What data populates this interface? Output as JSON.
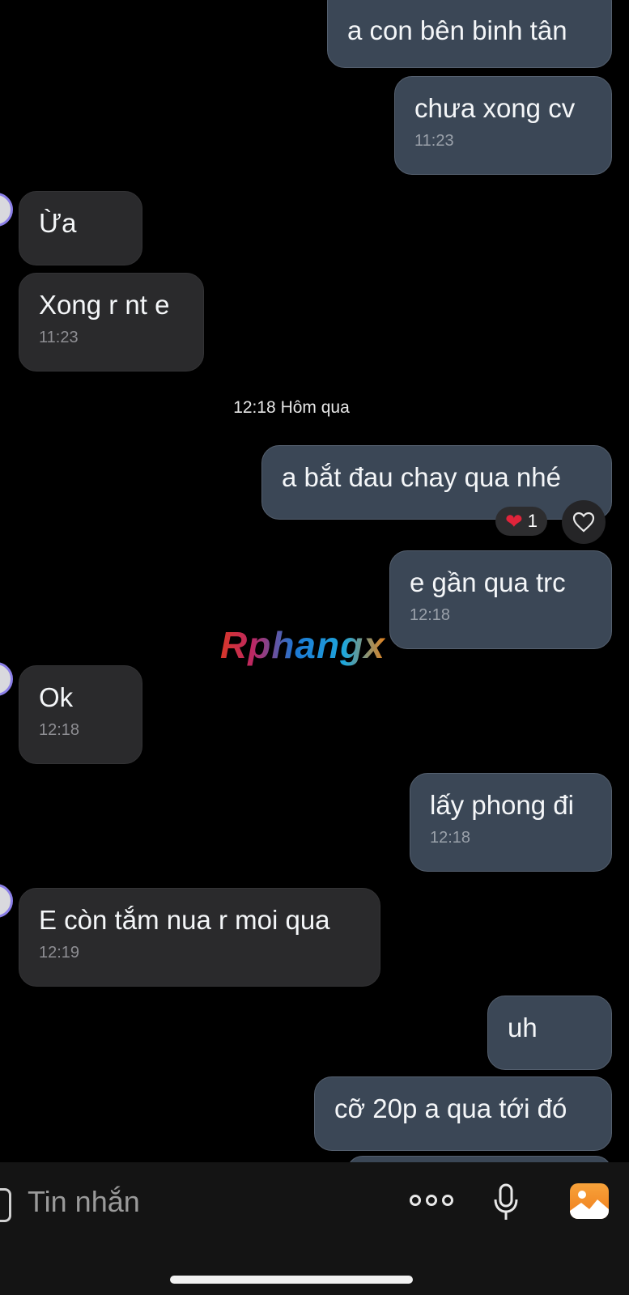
{
  "messages": [
    {
      "direction": "out",
      "text": "a con bên binh tân",
      "time": ""
    },
    {
      "direction": "out",
      "text": "chưa xong cv",
      "time": "11:23"
    },
    {
      "direction": "in",
      "text": "Ừa",
      "time": ""
    },
    {
      "direction": "in",
      "text": "Xong r nt e",
      "time": "11:23"
    },
    {
      "direction": "out",
      "text": "a bắt đau chay qua nhé",
      "time": ""
    },
    {
      "direction": "out",
      "text": "e gần qua trc",
      "time": "12:18"
    },
    {
      "direction": "in",
      "text": "Ok",
      "time": "12:18"
    },
    {
      "direction": "out",
      "text": "lấy phong đi",
      "time": "12:18"
    },
    {
      "direction": "in",
      "text": "E còn tắm nua r moi qua",
      "time": "12:19"
    },
    {
      "direction": "out",
      "text": "uh",
      "time": ""
    },
    {
      "direction": "out",
      "text": "cỡ 20p a qua tới đó",
      "time": ""
    }
  ],
  "day_divider": "12:18 Hôm qua",
  "reaction": {
    "emoji": "❤",
    "count": "1"
  },
  "watermark": "Rphangx",
  "composer": {
    "placeholder": "Tin nhắn",
    "icons": [
      "attachment-icon",
      "more-icon",
      "microphone-icon",
      "gallery-icon"
    ]
  },
  "colors": {
    "background": "#000000",
    "outgoing_bubble": "#3b4756",
    "incoming_bubble": "#2a2a2c",
    "accent": "#f07d1c"
  }
}
